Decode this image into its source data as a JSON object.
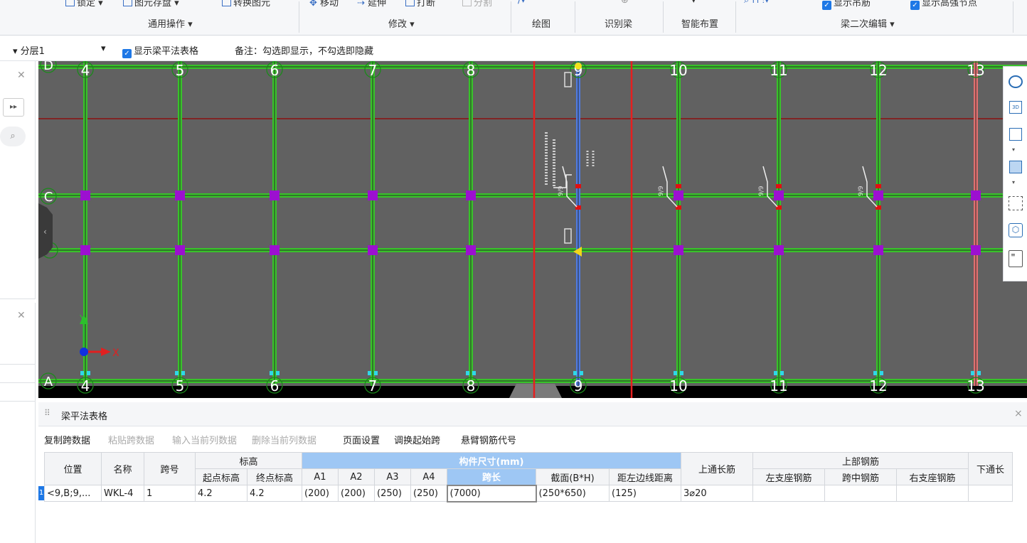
{
  "ribbon": {
    "lock": "锁定",
    "save_unit": "图元存盘",
    "convert_unit": "转换图元",
    "move": "移动",
    "extend": "延伸",
    "break": "打断",
    "split": "分割",
    "show_hanger": "显示吊筋",
    "show_high_node": "显示高强节点",
    "groups": {
      "common": "通用操作",
      "modify": "修改",
      "draw": "绘图",
      "identify": "识别梁",
      "smart": "智能布置",
      "edit2": "梁二次编辑"
    }
  },
  "floorbar": {
    "layer": "分层1",
    "show_table_label": "显示梁平法表格",
    "note": "备注：勾选即显示，不勾选即隐藏"
  },
  "grid": {
    "col_labels": [
      "4",
      "5",
      "6",
      "7",
      "8",
      "9",
      "10",
      "11",
      "12",
      "13"
    ],
    "row_labels": [
      "D",
      "C",
      "A"
    ],
    "axis_x": "X",
    "axis_y": "Y",
    "beam_text": [
      "9/9",
      "9/9",
      "9/9",
      "9/9"
    ]
  },
  "panel": {
    "title": "梁平法表格",
    "close": "×",
    "toolbar": [
      "复制跨数据",
      "粘贴跨数据",
      "输入当前列数据",
      "删除当前列数据",
      "页面设置",
      "调换起始跨",
      "悬臂钢筋代号"
    ],
    "toolbar_enabled": [
      true,
      false,
      false,
      false,
      true,
      true,
      true
    ],
    "headers": {
      "pos": "位置",
      "name": "名称",
      "span": "跨号",
      "elev": "标高",
      "elev_start": "起点标高",
      "elev_end": "终点标高",
      "size": "构件尺寸(mm)",
      "a1": "A1",
      "a2": "A2",
      "a3": "A3",
      "a4": "A4",
      "span_len": "跨长",
      "section": "截面(B*H)",
      "dist": "距左边线距离",
      "top_bar": "上通长筋",
      "top_rebar": "上部钢筋",
      "left_seat": "左支座钢筋",
      "mid_span": "跨中钢筋",
      "right_seat": "右支座钢筋",
      "bottom_bar": "下通长"
    },
    "row": {
      "idx": "1",
      "pos": "<9,B;9,...",
      "name": "WKL-4",
      "span": "1",
      "elev_start": "4.2",
      "elev_end": "4.2",
      "a1": "(200)",
      "a2": "(200)",
      "a3": "(250)",
      "a4": "(250)",
      "span_len": "(7000)",
      "section": "(250*650)",
      "dist": "(125)",
      "top_bar": "3⌀20",
      "left_seat": "",
      "mid_span": "",
      "right_seat": "",
      "bottom_bar": ""
    }
  },
  "colors": {
    "beam": "#38c22a",
    "selected_beam": "#4f7ae0",
    "highlight_beam": "#e07070",
    "column": "#9c10d0",
    "canvas_bg": "#616161",
    "highlight_box": "#e62020",
    "accent": "#1e78e6"
  }
}
